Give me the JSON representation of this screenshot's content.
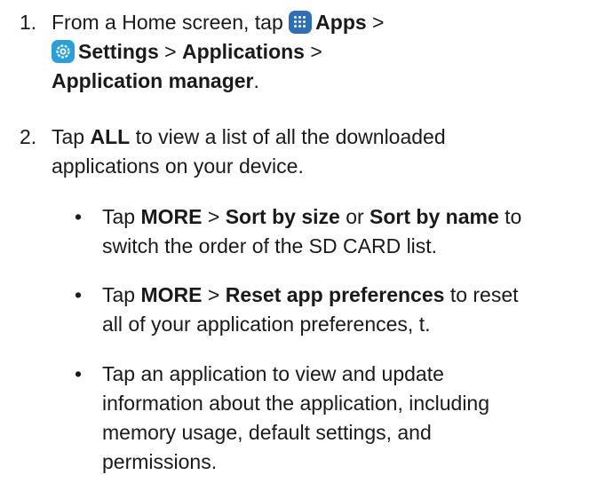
{
  "steps": [
    {
      "number": "1.",
      "lines": [
        {
          "pre": "From a Home screen, tap ",
          "icon": "apps-grid-icon",
          "bold": "Apps",
          "post": " >"
        },
        {
          "icon": "settings-gear-icon",
          "bold": "Settings",
          "mid": " > ",
          "bold2": "Applications",
          "post": " >"
        },
        {
          "bold": "Application manager",
          "post": "."
        }
      ]
    },
    {
      "number": "2.",
      "lines": [
        {
          "pre": "Tap ",
          "bold": "ALL",
          "post": " to view a list of all the downloaded"
        },
        {
          "pre": "applications on your device."
        }
      ]
    }
  ],
  "bullets": [
    {
      "symbol": "•",
      "lines": [
        {
          "pre": "Tap ",
          "bold": "MORE",
          "mid": " > ",
          "bold2": "Sort by size",
          "mid2": " or ",
          "bold3": "Sort by name",
          "post": " to"
        },
        {
          "pre": "switch the order of the SD CARD list."
        }
      ]
    },
    {
      "symbol": "•",
      "lines": [
        {
          "pre": "Tap ",
          "bold": "MORE",
          "mid": " > ",
          "bold2": "Reset app preferences",
          "post": " to reset"
        },
        {
          "pre": "all of your application preferences, t."
        }
      ]
    },
    {
      "symbol": "•",
      "lines": [
        {
          "pre": "Tap an application to view and update"
        },
        {
          "pre": "information about the application, including"
        },
        {
          "pre": "memory usage, default settings, and"
        },
        {
          "pre": "permissions."
        }
      ]
    }
  ],
  "colors": {
    "apps_icon": "#2f6fb6",
    "settings_icon": "#2b9fd9",
    "text": "#1a1a1a"
  }
}
